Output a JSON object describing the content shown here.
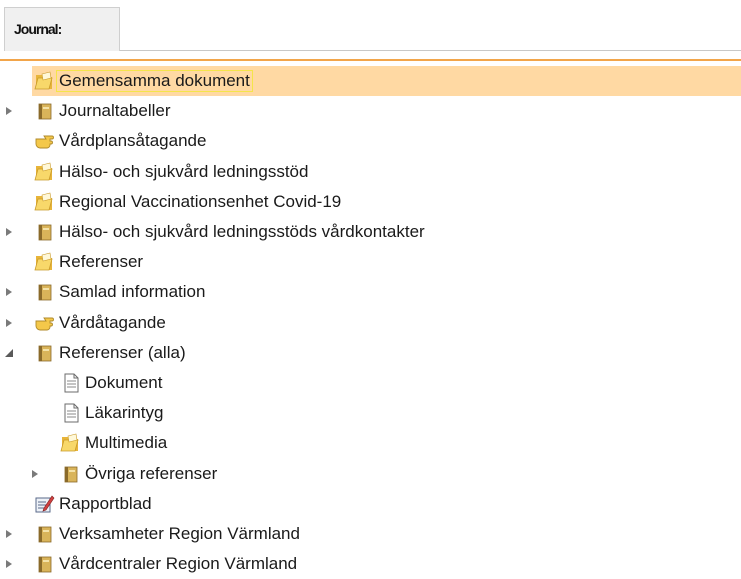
{
  "tab": {
    "label": "Journal:"
  },
  "tree": {
    "items": [
      {
        "label": "Gemensamma dokument",
        "icon": "folder-open-icon",
        "level": 0,
        "expander": "none",
        "selected": true
      },
      {
        "label": "Journaltabeller",
        "icon": "binder-icon",
        "level": 0,
        "expander": "collapsed"
      },
      {
        "label": "Vårdplansåtagande",
        "icon": "hand-pointer-icon",
        "level": 0,
        "expander": "none"
      },
      {
        "label": "Hälso- och sjukvård ledningsstöd",
        "icon": "folder-open-icon",
        "level": 0,
        "expander": "none"
      },
      {
        "label": "Regional Vaccinationsenhet Covid-19",
        "icon": "folder-open-icon",
        "level": 0,
        "expander": "none"
      },
      {
        "label": "Hälso- och sjukvård ledningsstöds vårdkontakter",
        "icon": "binder-icon",
        "level": 0,
        "expander": "collapsed"
      },
      {
        "label": "Referenser",
        "icon": "folder-open-icon",
        "level": 0,
        "expander": "none"
      },
      {
        "label": "Samlad information",
        "icon": "binder-icon",
        "level": 0,
        "expander": "collapsed"
      },
      {
        "label": "Vårdåtagande",
        "icon": "hand-pointer-icon",
        "level": 0,
        "expander": "collapsed"
      },
      {
        "label": "Referenser (alla)",
        "icon": "binder-icon",
        "level": 0,
        "expander": "expanded"
      },
      {
        "label": "Dokument",
        "icon": "document-icon",
        "level": 1,
        "expander": "none"
      },
      {
        "label": "Läkarintyg",
        "icon": "document-icon",
        "level": 1,
        "expander": "none"
      },
      {
        "label": "Multimedia",
        "icon": "folder-open-icon",
        "level": 1,
        "expander": "none"
      },
      {
        "label": "Övriga referenser",
        "icon": "binder-icon",
        "level": 1,
        "expander": "collapsed"
      },
      {
        "label": "Rapportblad",
        "icon": "report-pen-icon",
        "level": 0,
        "expander": "none"
      },
      {
        "label": "Verksamheter Region Värmland",
        "icon": "binder-icon",
        "level": 0,
        "expander": "collapsed"
      },
      {
        "label": "Vårdcentraler Region Värmland",
        "icon": "binder-icon",
        "level": 0,
        "expander": "collapsed"
      }
    ]
  },
  "colors": {
    "selection_bg": "#ffd9a3",
    "selection_border": "#f5e54a",
    "divider": "#f2a54a",
    "folder": "#f4c84a",
    "binder": "#c8a04a"
  }
}
